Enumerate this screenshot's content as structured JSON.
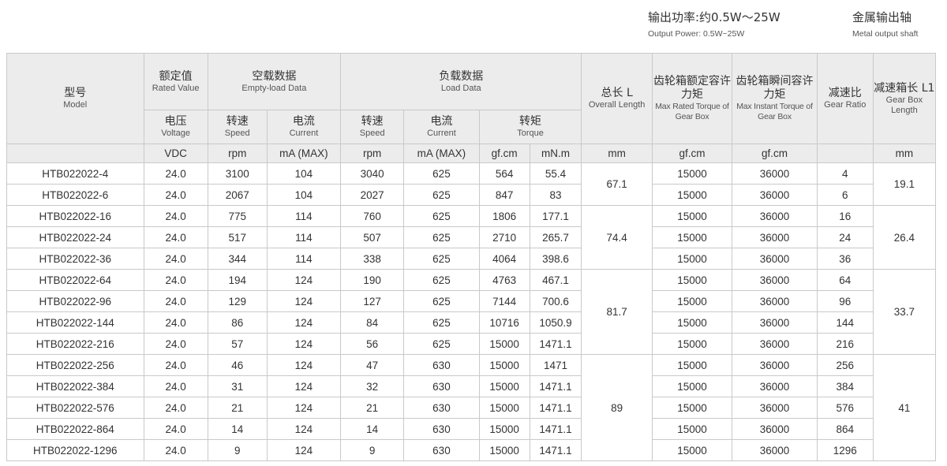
{
  "header": {
    "power_zh": "输出功率:约0.5W～25W",
    "power_en": "Output Power: 0.5W~25W",
    "shaft_zh": "金属输出轴",
    "shaft_en": "Metal output shaft"
  },
  "table": {
    "head": {
      "model_zh": "型号",
      "model_en": "Model",
      "rated_zh": "额定值",
      "rated_en": "Rated Value",
      "empty_zh": "空载数据",
      "empty_en": "Empty-load Data",
      "load_zh": "负载数据",
      "load_en": "Load Data",
      "length_zh": "总长 L",
      "length_en": "Overall Length",
      "rated_torque_zh": "齿轮箱额定容许力矩",
      "rated_torque_en": "Max Rated Torque of Gear Box",
      "instant_torque_zh": "齿轮箱瞬间容许力矩",
      "instant_torque_en": "Max Instant Torque of Gear Box",
      "ratio_zh": "减速比",
      "ratio_en": "Gear Ratio",
      "box_zh": "减速箱长 L1",
      "box_en": "Gear Box Length",
      "voltage_zh": "电压",
      "voltage_en": "Voltage",
      "speed_zh": "转速",
      "speed_en": "Speed",
      "current_zh": "电流",
      "current_en": "Current",
      "torque_zh": "转矩",
      "torque_en": "Torque"
    },
    "units": [
      "VDC",
      "rpm",
      "mA (MAX)",
      "rpm",
      "mA (MAX)",
      "gf.cm",
      "mN.m",
      "mm",
      "gf.cm",
      "gf.cm",
      "",
      "mm"
    ],
    "rows": [
      {
        "model": "HTB022022-4",
        "v": "24.0",
        "nl_speed": "3100",
        "nl_current": "104",
        "l_speed": "3040",
        "l_current": "625",
        "gfcm": "564",
        "mnm": "55.4",
        "rated_torque": "15000",
        "instant_torque": "36000",
        "ratio": "4"
      },
      {
        "model": "HTB022022-6",
        "v": "24.0",
        "nl_speed": "2067",
        "nl_current": "104",
        "l_speed": "2027",
        "l_current": "625",
        "gfcm": "847",
        "mnm": "83",
        "rated_torque": "15000",
        "instant_torque": "36000",
        "ratio": "6"
      },
      {
        "model": "HTB022022-16",
        "v": "24.0",
        "nl_speed": "775",
        "nl_current": "114",
        "l_speed": "760",
        "l_current": "625",
        "gfcm": "1806",
        "mnm": "177.1",
        "rated_torque": "15000",
        "instant_torque": "36000",
        "ratio": "16"
      },
      {
        "model": "HTB022022-24",
        "v": "24.0",
        "nl_speed": "517",
        "nl_current": "114",
        "l_speed": "507",
        "l_current": "625",
        "gfcm": "2710",
        "mnm": "265.7",
        "rated_torque": "15000",
        "instant_torque": "36000",
        "ratio": "24"
      },
      {
        "model": "HTB022022-36",
        "v": "24.0",
        "nl_speed": "344",
        "nl_current": "114",
        "l_speed": "338",
        "l_current": "625",
        "gfcm": "4064",
        "mnm": "398.6",
        "rated_torque": "15000",
        "instant_torque": "36000",
        "ratio": "36"
      },
      {
        "model": "HTB022022-64",
        "v": "24.0",
        "nl_speed": "194",
        "nl_current": "124",
        "l_speed": "190",
        "l_current": "625",
        "gfcm": "4763",
        "mnm": "467.1",
        "rated_torque": "15000",
        "instant_torque": "36000",
        "ratio": "64"
      },
      {
        "model": "HTB022022-96",
        "v": "24.0",
        "nl_speed": "129",
        "nl_current": "124",
        "l_speed": "127",
        "l_current": "625",
        "gfcm": "7144",
        "mnm": "700.6",
        "rated_torque": "15000",
        "instant_torque": "36000",
        "ratio": "96"
      },
      {
        "model": "HTB022022-144",
        "v": "24.0",
        "nl_speed": "86",
        "nl_current": "124",
        "l_speed": "84",
        "l_current": "625",
        "gfcm": "10716",
        "mnm": "1050.9",
        "rated_torque": "15000",
        "instant_torque": "36000",
        "ratio": "144"
      },
      {
        "model": "HTB022022-216",
        "v": "24.0",
        "nl_speed": "57",
        "nl_current": "124",
        "l_speed": "56",
        "l_current": "625",
        "gfcm": "15000",
        "mnm": "1471.1",
        "rated_torque": "15000",
        "instant_torque": "36000",
        "ratio": "216"
      },
      {
        "model": "HTB022022-256",
        "v": "24.0",
        "nl_speed": "46",
        "nl_current": "124",
        "l_speed": "47",
        "l_current": "630",
        "gfcm": "15000",
        "mnm": "1471",
        "rated_torque": "15000",
        "instant_torque": "36000",
        "ratio": "256"
      },
      {
        "model": "HTB022022-384",
        "v": "24.0",
        "nl_speed": "31",
        "nl_current": "124",
        "l_speed": "32",
        "l_current": "630",
        "gfcm": "15000",
        "mnm": "1471.1",
        "rated_torque": "15000",
        "instant_torque": "36000",
        "ratio": "384"
      },
      {
        "model": "HTB022022-576",
        "v": "24.0",
        "nl_speed": "21",
        "nl_current": "124",
        "l_speed": "21",
        "l_current": "630",
        "gfcm": "15000",
        "mnm": "1471.1",
        "rated_torque": "15000",
        "instant_torque": "36000",
        "ratio": "576"
      },
      {
        "model": "HTB022022-864",
        "v": "24.0",
        "nl_speed": "14",
        "nl_current": "124",
        "l_speed": "14",
        "l_current": "630",
        "gfcm": "15000",
        "mnm": "1471.1",
        "rated_torque": "15000",
        "instant_torque": "36000",
        "ratio": "864"
      },
      {
        "model": "HTB022022-1296",
        "v": "24.0",
        "nl_speed": "9",
        "nl_current": "124",
        "l_speed": "9",
        "l_current": "630",
        "gfcm": "15000",
        "mnm": "1471.1",
        "rated_torque": "15000",
        "instant_torque": "36000",
        "ratio": "1296"
      }
    ],
    "overall_length": [
      {
        "value": "67.1",
        "span": 2
      },
      {
        "value": "74.4",
        "span": 3
      },
      {
        "value": "81.7",
        "span": 4
      },
      {
        "value": "89",
        "span": 5
      }
    ],
    "box_length": [
      {
        "value": "19.1",
        "span": 2
      },
      {
        "value": "26.4",
        "span": 3
      },
      {
        "value": "33.7",
        "span": 4
      },
      {
        "value": "41",
        "span": 5
      }
    ]
  }
}
